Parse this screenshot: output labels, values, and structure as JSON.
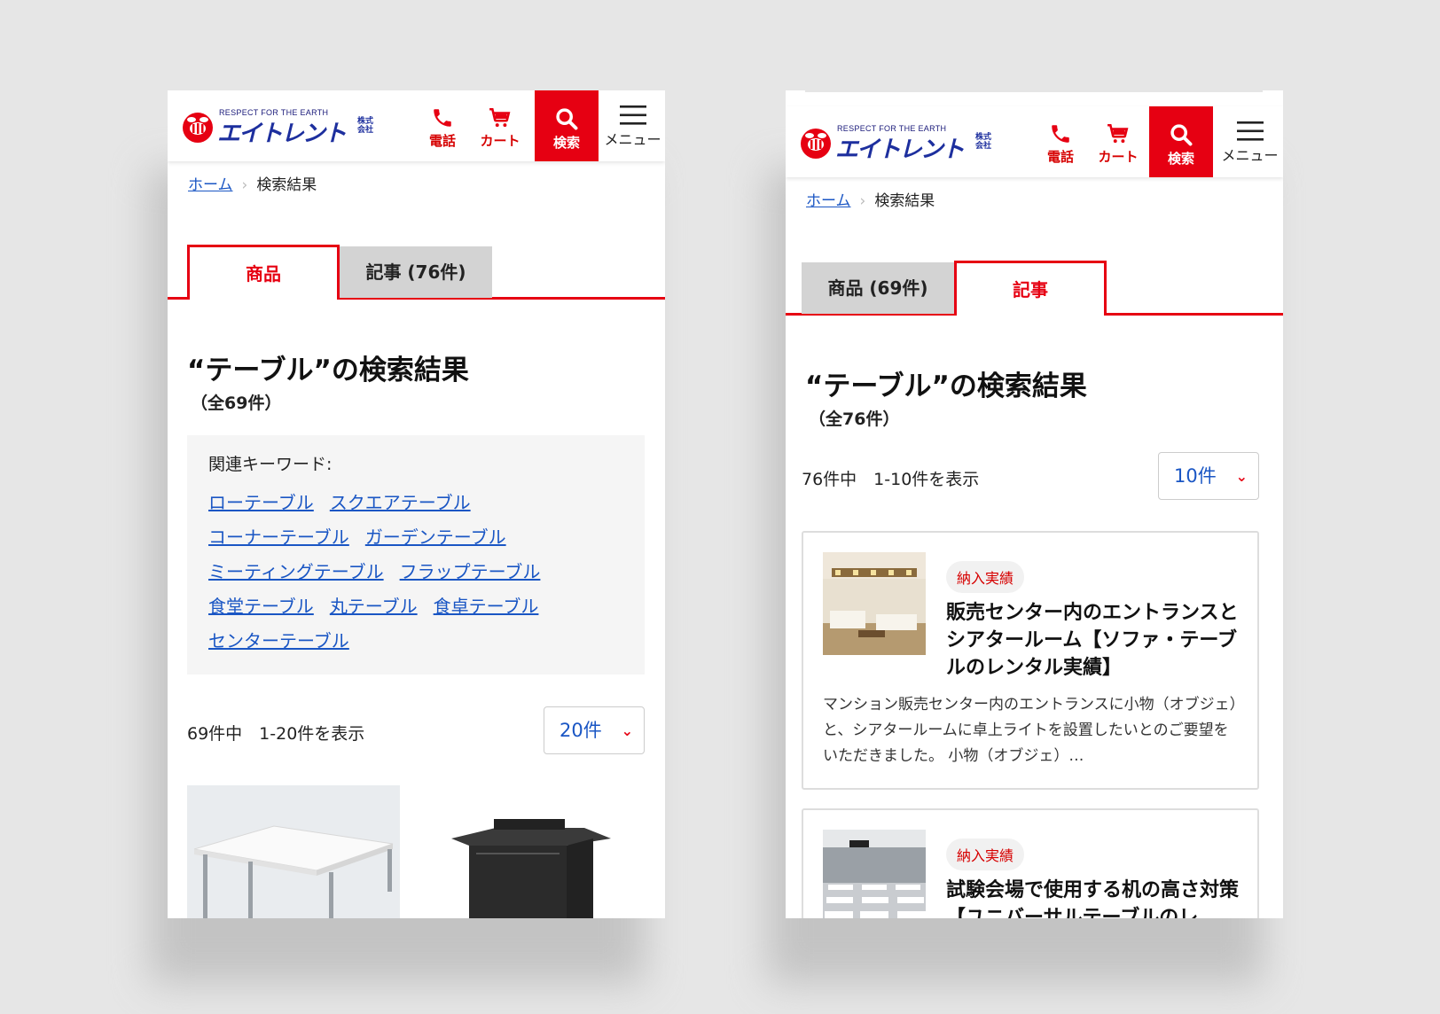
{
  "logo": {
    "tagline": "RESPECT FOR THE EARTH",
    "name": "エイトレント",
    "suffix": "株式会社"
  },
  "header": {
    "phone_label": "電話",
    "cart_label": "カート",
    "search_label": "検索",
    "menu_label": "メニュー"
  },
  "breadcrumb": {
    "home": "ホーム",
    "separator": "›",
    "current": "検索結果"
  },
  "colors": {
    "accent": "#e60012",
    "link": "#1a56c4",
    "brand_blue": "#1d2f9e"
  },
  "screen1": {
    "tabs": [
      {
        "label": "商品",
        "active": true
      },
      {
        "label": "記事 (76件)",
        "active": false
      }
    ],
    "title": "“テーブル”の検索結果",
    "count": "（全69件）",
    "keywords_label": "関連キーワード:",
    "keywords": [
      "ローテーブル",
      "スクエアテーブル",
      "コーナーテーブル",
      "ガーデンテーブル",
      "ミーティングテーブル",
      "フラップテーブル",
      "食堂テーブル",
      "丸テーブル",
      "食卓テーブル",
      "センターテーブル"
    ],
    "pager_text": "69件中　1-20件を表示",
    "per_page": "20件"
  },
  "screen2": {
    "tabs": [
      {
        "label": "商品 (69件)",
        "active": false
      },
      {
        "label": "記事",
        "active": true
      }
    ],
    "title": "“テーブル”の検索結果",
    "count": "（全76件）",
    "pager_text": "76件中　1-10件を表示",
    "per_page": "10件",
    "articles": [
      {
        "badge": "納入実績",
        "title": "販売センター内のエントランスとシアタールーム【ソファ・テーブルのレンタル実績】",
        "desc": "マンション販売センター内のエントランスに小物（オブジェ）と、シアタールームに卓上ライトを設置したいとのご要望をいただきました。 小物（オブジェ）…"
      },
      {
        "badge": "納入実績",
        "title": "試験会場で使用する机の高さ対策【ユニバーサルテーブルのレ"
      }
    ]
  }
}
